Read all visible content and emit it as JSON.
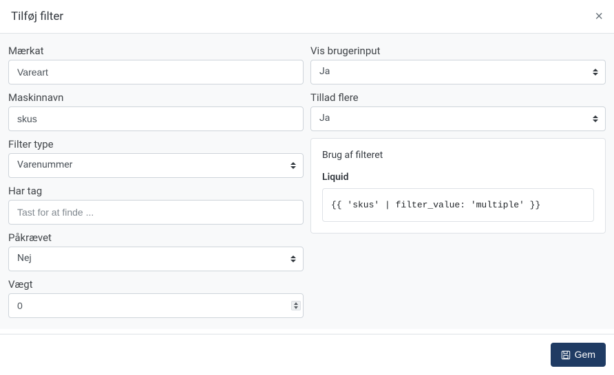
{
  "header": {
    "title": "Tilføj filter"
  },
  "left": {
    "label": {
      "label": "Mærkat",
      "value": "Vareart"
    },
    "machine_name": {
      "label": "Maskinnavn",
      "value": "skus"
    },
    "filter_type": {
      "label": "Filter type",
      "value": "Varenummer"
    },
    "has_tag": {
      "label": "Har tag",
      "placeholder": "Tast for at finde ..."
    },
    "required": {
      "label": "Påkrævet",
      "value": "Nej"
    },
    "weight": {
      "label": "Vægt",
      "value": "0"
    }
  },
  "right": {
    "show_user_input": {
      "label": "Vis brugerinput",
      "value": "Ja"
    },
    "allow_multiple": {
      "label": "Tillad flere",
      "value": "Ja"
    },
    "usage": {
      "heading": "Brug af filteret",
      "liquid_label": "Liquid",
      "code": "{{ 'skus' | filter_value: 'multiple' }}"
    }
  },
  "footer": {
    "save_label": "Gem"
  }
}
